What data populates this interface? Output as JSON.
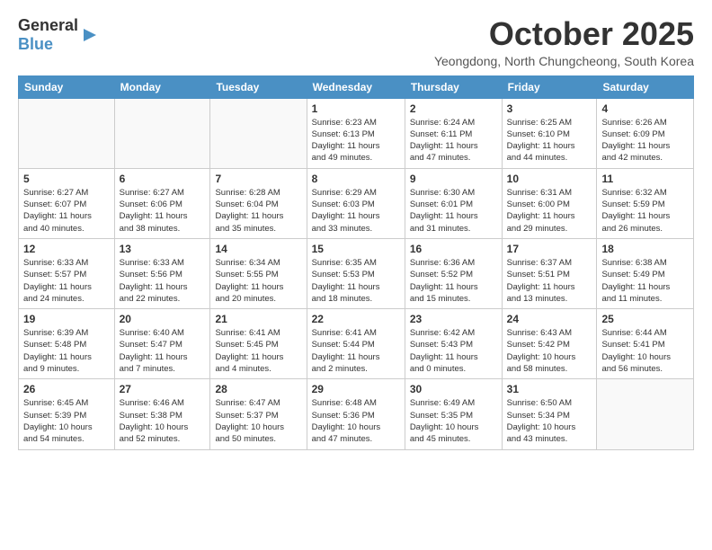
{
  "header": {
    "logo_general": "General",
    "logo_blue": "Blue",
    "month": "October 2025",
    "location": "Yeongdong, North Chungcheong, South Korea"
  },
  "weekdays": [
    "Sunday",
    "Monday",
    "Tuesday",
    "Wednesday",
    "Thursday",
    "Friday",
    "Saturday"
  ],
  "weeks": [
    [
      {
        "day": "",
        "info": ""
      },
      {
        "day": "",
        "info": ""
      },
      {
        "day": "",
        "info": ""
      },
      {
        "day": "1",
        "info": "Sunrise: 6:23 AM\nSunset: 6:13 PM\nDaylight: 11 hours\nand 49 minutes."
      },
      {
        "day": "2",
        "info": "Sunrise: 6:24 AM\nSunset: 6:11 PM\nDaylight: 11 hours\nand 47 minutes."
      },
      {
        "day": "3",
        "info": "Sunrise: 6:25 AM\nSunset: 6:10 PM\nDaylight: 11 hours\nand 44 minutes."
      },
      {
        "day": "4",
        "info": "Sunrise: 6:26 AM\nSunset: 6:09 PM\nDaylight: 11 hours\nand 42 minutes."
      }
    ],
    [
      {
        "day": "5",
        "info": "Sunrise: 6:27 AM\nSunset: 6:07 PM\nDaylight: 11 hours\nand 40 minutes."
      },
      {
        "day": "6",
        "info": "Sunrise: 6:27 AM\nSunset: 6:06 PM\nDaylight: 11 hours\nand 38 minutes."
      },
      {
        "day": "7",
        "info": "Sunrise: 6:28 AM\nSunset: 6:04 PM\nDaylight: 11 hours\nand 35 minutes."
      },
      {
        "day": "8",
        "info": "Sunrise: 6:29 AM\nSunset: 6:03 PM\nDaylight: 11 hours\nand 33 minutes."
      },
      {
        "day": "9",
        "info": "Sunrise: 6:30 AM\nSunset: 6:01 PM\nDaylight: 11 hours\nand 31 minutes."
      },
      {
        "day": "10",
        "info": "Sunrise: 6:31 AM\nSunset: 6:00 PM\nDaylight: 11 hours\nand 29 minutes."
      },
      {
        "day": "11",
        "info": "Sunrise: 6:32 AM\nSunset: 5:59 PM\nDaylight: 11 hours\nand 26 minutes."
      }
    ],
    [
      {
        "day": "12",
        "info": "Sunrise: 6:33 AM\nSunset: 5:57 PM\nDaylight: 11 hours\nand 24 minutes."
      },
      {
        "day": "13",
        "info": "Sunrise: 6:33 AM\nSunset: 5:56 PM\nDaylight: 11 hours\nand 22 minutes."
      },
      {
        "day": "14",
        "info": "Sunrise: 6:34 AM\nSunset: 5:55 PM\nDaylight: 11 hours\nand 20 minutes."
      },
      {
        "day": "15",
        "info": "Sunrise: 6:35 AM\nSunset: 5:53 PM\nDaylight: 11 hours\nand 18 minutes."
      },
      {
        "day": "16",
        "info": "Sunrise: 6:36 AM\nSunset: 5:52 PM\nDaylight: 11 hours\nand 15 minutes."
      },
      {
        "day": "17",
        "info": "Sunrise: 6:37 AM\nSunset: 5:51 PM\nDaylight: 11 hours\nand 13 minutes."
      },
      {
        "day": "18",
        "info": "Sunrise: 6:38 AM\nSunset: 5:49 PM\nDaylight: 11 hours\nand 11 minutes."
      }
    ],
    [
      {
        "day": "19",
        "info": "Sunrise: 6:39 AM\nSunset: 5:48 PM\nDaylight: 11 hours\nand 9 minutes."
      },
      {
        "day": "20",
        "info": "Sunrise: 6:40 AM\nSunset: 5:47 PM\nDaylight: 11 hours\nand 7 minutes."
      },
      {
        "day": "21",
        "info": "Sunrise: 6:41 AM\nSunset: 5:45 PM\nDaylight: 11 hours\nand 4 minutes."
      },
      {
        "day": "22",
        "info": "Sunrise: 6:41 AM\nSunset: 5:44 PM\nDaylight: 11 hours\nand 2 minutes."
      },
      {
        "day": "23",
        "info": "Sunrise: 6:42 AM\nSunset: 5:43 PM\nDaylight: 11 hours\nand 0 minutes."
      },
      {
        "day": "24",
        "info": "Sunrise: 6:43 AM\nSunset: 5:42 PM\nDaylight: 10 hours\nand 58 minutes."
      },
      {
        "day": "25",
        "info": "Sunrise: 6:44 AM\nSunset: 5:41 PM\nDaylight: 10 hours\nand 56 minutes."
      }
    ],
    [
      {
        "day": "26",
        "info": "Sunrise: 6:45 AM\nSunset: 5:39 PM\nDaylight: 10 hours\nand 54 minutes."
      },
      {
        "day": "27",
        "info": "Sunrise: 6:46 AM\nSunset: 5:38 PM\nDaylight: 10 hours\nand 52 minutes."
      },
      {
        "day": "28",
        "info": "Sunrise: 6:47 AM\nSunset: 5:37 PM\nDaylight: 10 hours\nand 50 minutes."
      },
      {
        "day": "29",
        "info": "Sunrise: 6:48 AM\nSunset: 5:36 PM\nDaylight: 10 hours\nand 47 minutes."
      },
      {
        "day": "30",
        "info": "Sunrise: 6:49 AM\nSunset: 5:35 PM\nDaylight: 10 hours\nand 45 minutes."
      },
      {
        "day": "31",
        "info": "Sunrise: 6:50 AM\nSunset: 5:34 PM\nDaylight: 10 hours\nand 43 minutes."
      },
      {
        "day": "",
        "info": ""
      }
    ]
  ]
}
